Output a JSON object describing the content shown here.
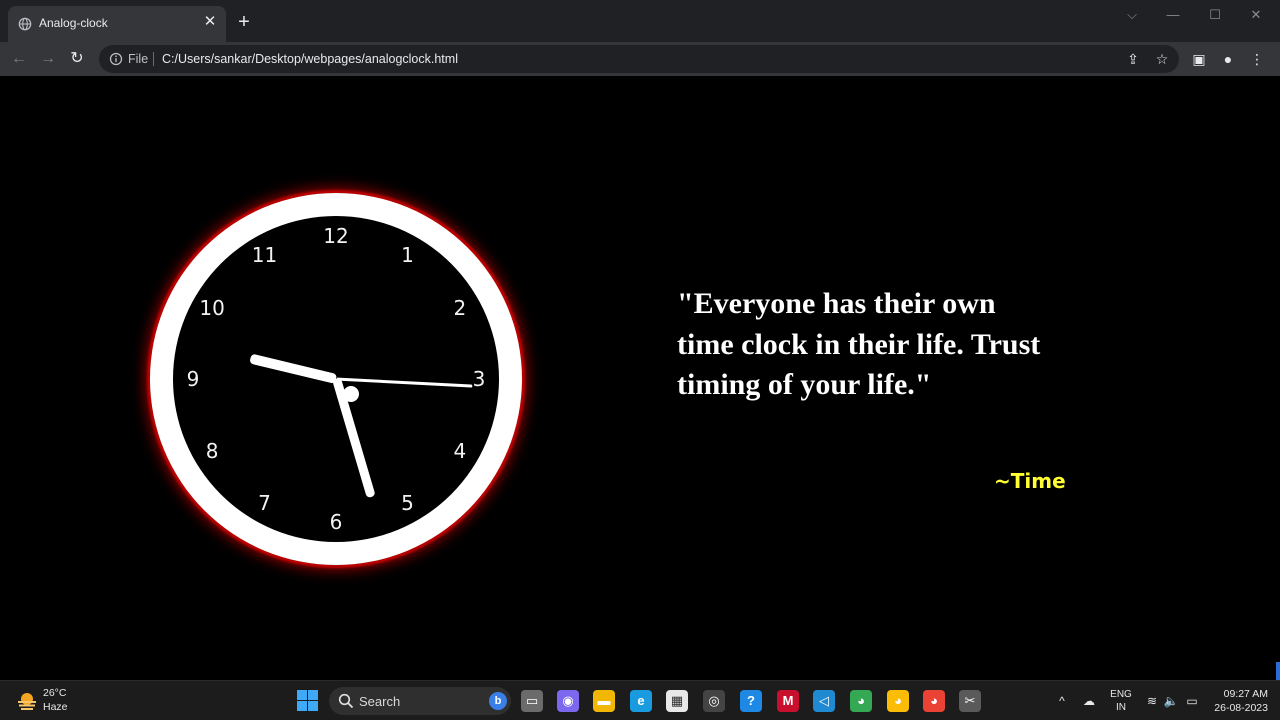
{
  "browser": {
    "tab_title": "Analog-clock",
    "tab_close": "✕",
    "new_tab": "+",
    "window_controls": {
      "dropdown": "⌵",
      "minimize": "—",
      "maximize": "☐",
      "close": "✕"
    },
    "nav": {
      "back": "←",
      "forward": "→",
      "reload": "↻"
    },
    "omnibox": {
      "scheme_label": "File",
      "url": "C:/Users/sankar/Desktop/webpages/analogclock.html"
    },
    "icons": {
      "share": "⇪",
      "bookmark": "☆",
      "side_panel": "▣",
      "profile": "●",
      "menu": "⋮"
    },
    "colors": {
      "titlebar": "#202124",
      "toolbar": "#35363a",
      "omnibox": "#202124"
    }
  },
  "page": {
    "clock": {
      "numbers": [
        "12",
        "1",
        "2",
        "3",
        "4",
        "5",
        "6",
        "7",
        "8",
        "9",
        "10",
        "11"
      ],
      "time": {
        "hours": 9,
        "minutes": 27,
        "seconds": 15.5
      },
      "colors": {
        "glow": "#c00000",
        "ring": "#ffffff",
        "face": "#000000",
        "hands": "#ffffff"
      }
    },
    "quote": "\"Everyone has their own time clock in their life. Trust timing of your life.\"",
    "author": "~Time",
    "author_color": "#ffff33"
  },
  "taskbar": {
    "weather": {
      "temp": "26°C",
      "desc": "Haze"
    },
    "search_label": "Search",
    "bing_badge": "b",
    "apps": [
      {
        "name": "task-view",
        "glyph": "▭",
        "color": "#6b6b6b"
      },
      {
        "name": "teams-chat",
        "glyph": "◉",
        "color": "#7b68ee"
      },
      {
        "name": "file-explorer",
        "glyph": "▬",
        "color": "#f2b705"
      },
      {
        "name": "edge",
        "glyph": "e",
        "color": "#1a9be0"
      },
      {
        "name": "microsoft-store",
        "glyph": "▦",
        "color": "#e8e8e8"
      },
      {
        "name": "github",
        "glyph": "◎",
        "color": "#444444"
      },
      {
        "name": "help",
        "glyph": "?",
        "color": "#1e88e5"
      },
      {
        "name": "mcafee",
        "glyph": "M",
        "color": "#c8102e"
      },
      {
        "name": "vscode",
        "glyph": "◁",
        "color": "#1f8ad2"
      },
      {
        "name": "chrome",
        "glyph": "◕",
        "color": "#34a853"
      },
      {
        "name": "chrome-dev",
        "glyph": "◕",
        "color": "#fbbc05"
      },
      {
        "name": "chrome-profile",
        "glyph": "◕",
        "color": "#ea4335"
      },
      {
        "name": "snipping-tool",
        "glyph": "✂",
        "color": "#5a5a5a"
      }
    ],
    "tray": {
      "chevron": "^",
      "onedrive": "☁",
      "wifi": "≋",
      "volume": "🔈",
      "battery": "▭"
    },
    "language": {
      "line1": "ENG",
      "line2": "IN"
    },
    "time": "09:27 AM",
    "date": "26-08-2023"
  }
}
